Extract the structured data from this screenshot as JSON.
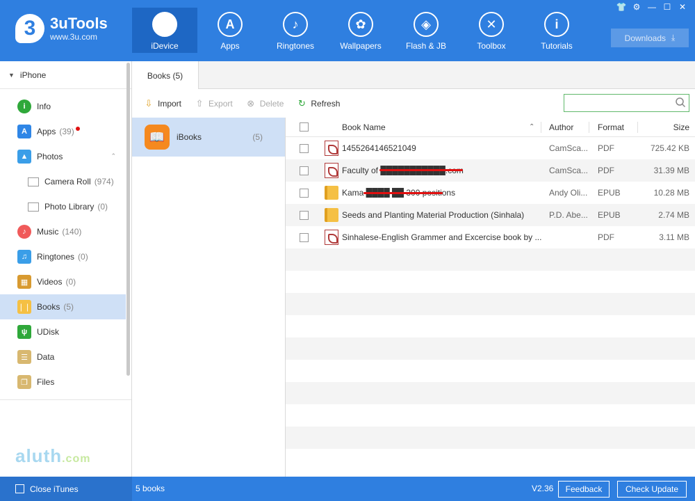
{
  "app": {
    "title": "3uTools",
    "url": "www.3u.com",
    "logo_mark": "3"
  },
  "nav": [
    {
      "label": "iDevice",
      "icon": "apple-icon",
      "glyph": "",
      "active": true
    },
    {
      "label": "Apps",
      "icon": "appstore-icon",
      "glyph": "A"
    },
    {
      "label": "Ringtones",
      "icon": "bell-icon",
      "glyph": "♪"
    },
    {
      "label": "Wallpapers",
      "icon": "flower-icon",
      "glyph": "✿"
    },
    {
      "label": "Flash & JB",
      "icon": "box-icon",
      "glyph": "◈"
    },
    {
      "label": "Toolbox",
      "icon": "tools-icon",
      "glyph": "✕"
    },
    {
      "label": "Tutorials",
      "icon": "info-icon",
      "glyph": "i"
    }
  ],
  "window_controls": [
    "shirt-icon",
    "gear-icon",
    "minimize-icon",
    "maximize-icon",
    "close-icon"
  ],
  "downloads": {
    "label": "Downloads"
  },
  "device": {
    "name": "iPhone"
  },
  "sidebar": {
    "items": [
      {
        "label": "Info",
        "count": "",
        "icon": "info-icon",
        "color": "#2fa83a",
        "glyph": "i"
      },
      {
        "label": "Apps",
        "count": "(39)",
        "icon": "apps-icon",
        "color": "#2f86e6",
        "glyph": "A",
        "badge": true
      },
      {
        "label": "Photos",
        "count": "",
        "icon": "photos-icon",
        "color": "#3a9ee8",
        "glyph": "▲",
        "expanded": true
      },
      {
        "label": "Camera Roll",
        "count": "(974)",
        "icon": "folder-icon",
        "color": "#ffffff",
        "glyph": "",
        "sub": true
      },
      {
        "label": "Photo Library",
        "count": "(0)",
        "icon": "folder-icon",
        "color": "#ffffff",
        "glyph": "",
        "sub": true
      },
      {
        "label": "Music",
        "count": "(140)",
        "icon": "music-icon",
        "color": "#f05a5a",
        "glyph": "♪"
      },
      {
        "label": "Ringtones",
        "count": "(0)",
        "icon": "bell-icon",
        "color": "#3a9ee8",
        "glyph": "♫"
      },
      {
        "label": "Videos",
        "count": "(0)",
        "icon": "film-icon",
        "color": "#d89a30",
        "glyph": "▦"
      },
      {
        "label": "Books",
        "count": "(5)",
        "icon": "book-icon",
        "color": "#f5c044",
        "glyph": "❘❘",
        "active": true
      },
      {
        "label": "UDisk",
        "count": "",
        "icon": "usb-icon",
        "color": "#2fa83a",
        "glyph": "ψ"
      },
      {
        "label": "Data",
        "count": "",
        "icon": "data-icon",
        "color": "#d8b870",
        "glyph": "☰"
      },
      {
        "label": "Files",
        "count": "",
        "icon": "files-icon",
        "color": "#d8b870",
        "glyph": "❐"
      }
    ]
  },
  "watermark": {
    "text": "aluth",
    "suffix": ".com"
  },
  "tab": {
    "label": "Books (5)"
  },
  "toolbar": {
    "import": "Import",
    "export": "Export",
    "delete": "Delete",
    "refresh": "Refresh"
  },
  "search": {
    "value": "",
    "placeholder": ""
  },
  "category": {
    "label": "iBooks",
    "count": "(5)"
  },
  "table": {
    "columns": {
      "name": "Book Name",
      "author": "Author",
      "format": "Format",
      "size": "Size"
    },
    "rows": [
      {
        "name": "1455264146521049",
        "author": "CamSca...",
        "format": "PDF",
        "size": "725.42 KB",
        "type": "pdf"
      },
      {
        "name": "Faculty of ███████████.com",
        "author": "CamSca...",
        "format": "PDF",
        "size": "31.39 MB",
        "type": "pdf",
        "redact": true
      },
      {
        "name": "Kama ████ ██ 300 positions",
        "author": "Andy Oli...",
        "format": "EPUB",
        "size": "10.28 MB",
        "type": "epub",
        "redact": true
      },
      {
        "name": "Seeds and Planting Material Production (Sinhala)",
        "author": "P.D. Abe...",
        "format": "EPUB",
        "size": "2.74 MB",
        "type": "epub"
      },
      {
        "name": "Sinhalese-English Grammer and Excercise book by ...",
        "author": "",
        "format": "PDF",
        "size": "3.11 MB",
        "type": "pdf"
      }
    ]
  },
  "status": {
    "close_itunes": "Close iTunes",
    "count": "5 books",
    "version": "V2.36",
    "feedback": "Feedback",
    "check_update": "Check Update"
  }
}
